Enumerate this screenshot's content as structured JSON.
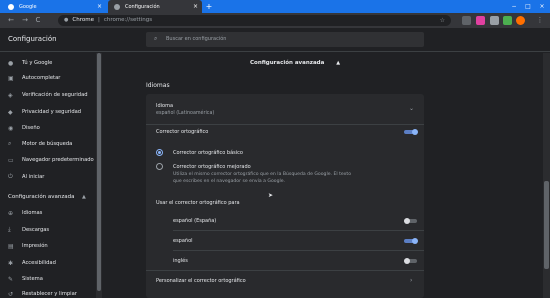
{
  "tabs": [
    {
      "label": "Google",
      "close": "×"
    },
    {
      "label": "Configuración",
      "close": "×"
    }
  ],
  "new_tab": "+",
  "window_controls": [
    "−",
    "□",
    "×"
  ],
  "toolbar": {
    "back": "←",
    "forward": "→",
    "reload": "C",
    "site": "Chrome",
    "separator": "|",
    "path": "chrome://settings",
    "star": "☆"
  },
  "header": {
    "title": "Configuración",
    "search_placeholder": "Buscar en configuración"
  },
  "sidebar": {
    "items": [
      {
        "label": "Tú y Google",
        "icon": "person-icon"
      },
      {
        "label": "Autocompletar",
        "icon": "clipboard-icon"
      },
      {
        "label": "Verificación de seguridad",
        "icon": "shield-icon"
      },
      {
        "label": "Privacidad y seguridad",
        "icon": "shield-lock-icon"
      },
      {
        "label": "Diseño",
        "icon": "palette-icon"
      },
      {
        "label": "Motor de búsqueda",
        "icon": "search-icon"
      },
      {
        "label": "Navegador predeterminado",
        "icon": "browser-icon"
      },
      {
        "label": "Al iniciar",
        "icon": "power-icon"
      }
    ],
    "advanced": {
      "label": "Configuración avanzada",
      "caret": "▲"
    },
    "advanced_items": [
      {
        "label": "Idiomas",
        "icon": "globe-icon"
      },
      {
        "label": "Descargas",
        "icon": "download-icon"
      },
      {
        "label": "Impresión",
        "icon": "printer-icon"
      },
      {
        "label": "Accesibilidad",
        "icon": "accessibility-icon"
      },
      {
        "label": "Sistema",
        "icon": "wrench-icon"
      },
      {
        "label": "Restablecer y limpiar",
        "icon": "reset-icon"
      }
    ]
  },
  "main": {
    "advanced_heading": "Configuración avanzada",
    "advanced_caret": "▲",
    "section_title": "Idiomas",
    "language": {
      "label": "Idioma",
      "value": "español (Latinoamérica)"
    },
    "spellcheck": {
      "label": "Corrector ortográfico",
      "enabled": true,
      "basic_label": "Corrector ortográfico básico",
      "enhanced_label": "Corrector ortográfico mejorado",
      "enhanced_desc_1": "Utiliza el mismo corrector ortográfico que en la Búsqueda de Google. El texto",
      "enhanced_desc_2": "que escribes en el navegador se envía a Google.",
      "selected": "basic"
    },
    "use_for_label": "Usar el corrector ortográfico para",
    "languages": [
      {
        "label": "español (España)",
        "enabled": false
      },
      {
        "label": "español",
        "enabled": true
      },
      {
        "label": "inglés",
        "enabled": false
      }
    ],
    "customize_label": "Personalizar el corrector ortográfico"
  },
  "colors": {
    "accent": "#8ab4f8",
    "tab_active_bg": "#1a73e8",
    "background": "#202124",
    "card": "#292a2d"
  }
}
